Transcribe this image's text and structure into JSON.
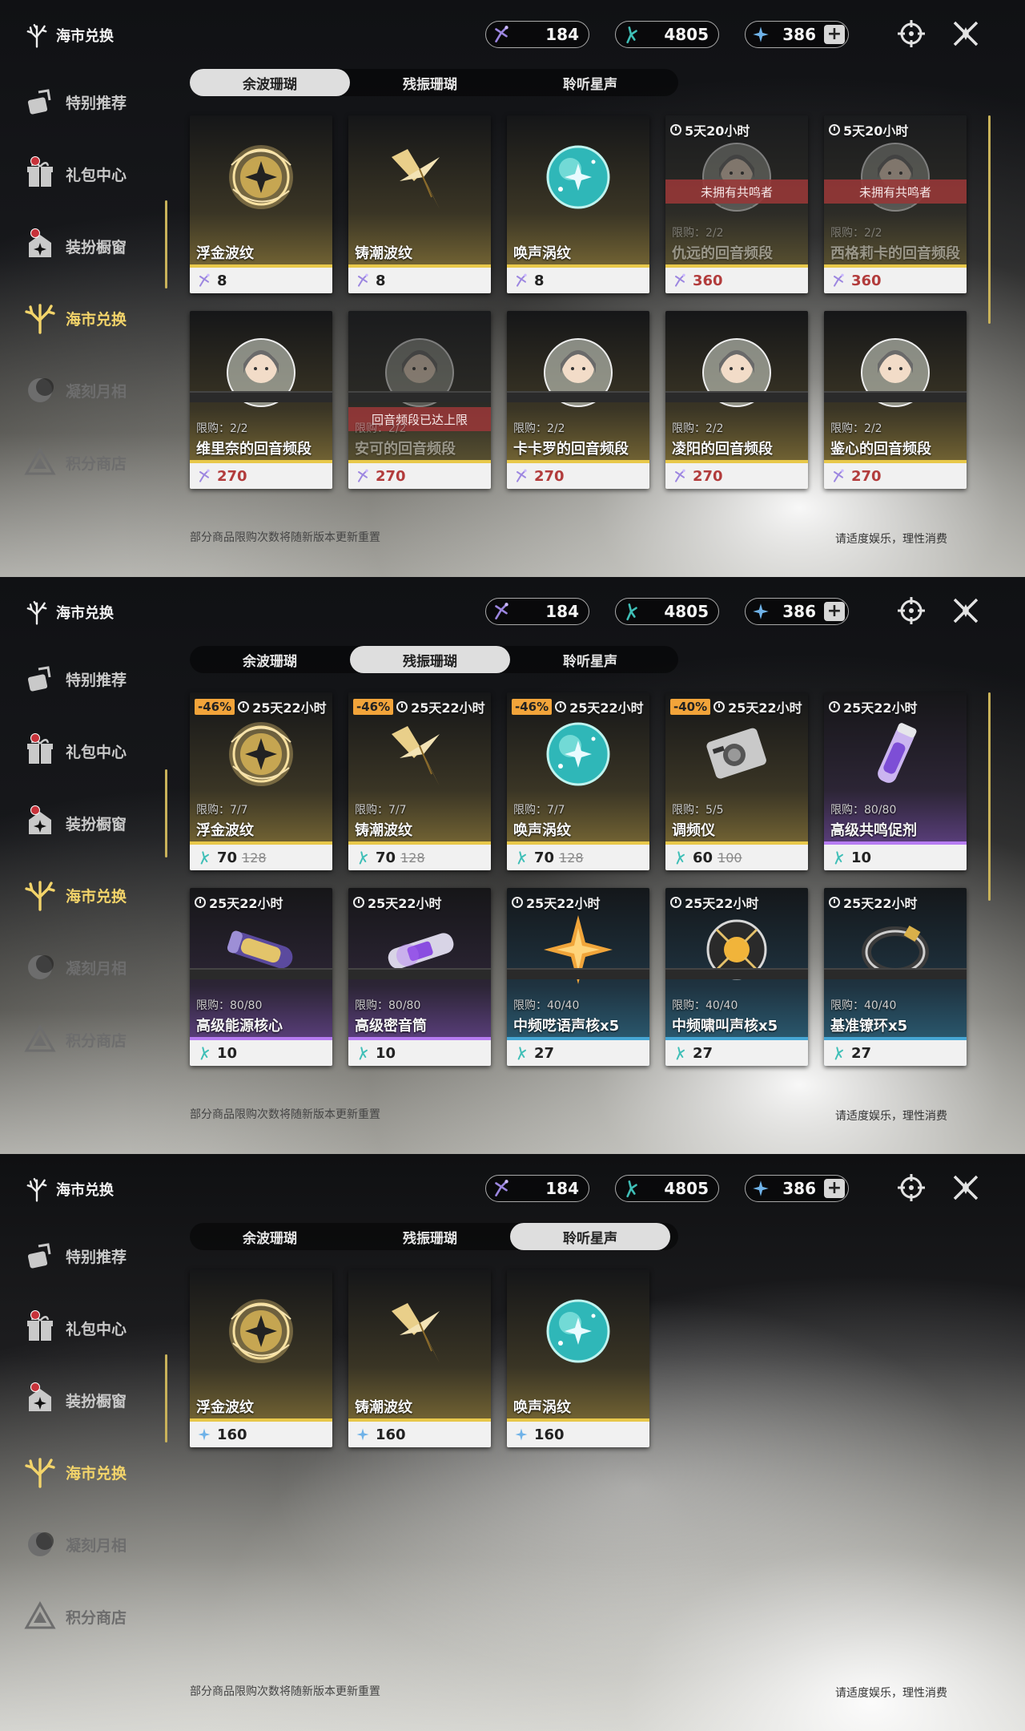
{
  "header": {
    "title": "海市兑换"
  },
  "sidebar": {
    "items": [
      {
        "label": "特别推荐",
        "icon": "recommend-icon"
      },
      {
        "label": "礼包中心",
        "icon": "gift-icon"
      },
      {
        "label": "装扮橱窗",
        "icon": "wardrobe-icon"
      },
      {
        "label": "海市兑换",
        "icon": "coral-exchange-icon"
      },
      {
        "label": "凝刻月相",
        "icon": "moon-icon"
      },
      {
        "label": "积分商店",
        "icon": "points-shop-icon"
      }
    ]
  },
  "currencies": [
    {
      "name": "coral-a",
      "value": "184",
      "color": "#b9a4e8"
    },
    {
      "name": "coral-b",
      "value": "4805",
      "color": "#6fd4d0"
    },
    {
      "name": "star-coin",
      "value": "386",
      "color": "#9fd3ff",
      "plus": "+"
    }
  ],
  "tabs": [
    "余波珊瑚",
    "残振珊瑚",
    "聆听星声"
  ],
  "panel1": {
    "cards": [
      {
        "name": "浮金波纹",
        "price": "8"
      },
      {
        "name": "铸潮波纹",
        "price": "8"
      },
      {
        "name": "唤声涡纹",
        "price": "8"
      },
      {
        "name": "仇远的回音频段",
        "price": "360",
        "timer": "5天20小时",
        "banner": "未拥有共鸣者",
        "limit": "限购：2/2"
      },
      {
        "name": "西格莉卡的回音频段",
        "price": "360",
        "timer": "5天20小时",
        "banner": "未拥有共鸣者",
        "limit": "限购：2/2"
      },
      {
        "name": "维里奈的回音频段",
        "price": "270",
        "limit": "限购：2/2"
      },
      {
        "name": "安可的回音频段",
        "price": "270",
        "limit": "限购：2/2",
        "banner": "回音频段已达上限"
      },
      {
        "name": "卡卡罗的回音频段",
        "price": "270",
        "limit": "限购：2/2"
      },
      {
        "name": "凌阳的回音频段",
        "price": "270",
        "limit": "限购：2/2"
      },
      {
        "name": "鉴心的回音频段",
        "price": "270",
        "limit": "限购：2/2"
      }
    ]
  },
  "panel2": {
    "cards": [
      {
        "name": "浮金波纹",
        "price": "70",
        "old": "128",
        "discount": "-46%",
        "timer": "25天22小时",
        "limit": "限购：7/7"
      },
      {
        "name": "铸潮波纹",
        "price": "70",
        "old": "128",
        "discount": "-46%",
        "timer": "25天22小时",
        "limit": "限购：7/7"
      },
      {
        "name": "唤声涡纹",
        "price": "70",
        "old": "128",
        "discount": "-46%",
        "timer": "25天22小时",
        "limit": "限购：7/7"
      },
      {
        "name": "调频仪",
        "price": "60",
        "old": "100",
        "discount": "-40%",
        "timer": "25天22小时",
        "limit": "限购：5/5"
      },
      {
        "name": "高级共鸣促剂",
        "price": "10",
        "timer": "25天22小时",
        "limit": "限购：80/80"
      },
      {
        "name": "高级能源核心",
        "price": "10",
        "timer": "25天22小时",
        "limit": "限购：80/80"
      },
      {
        "name": "高级密音筒",
        "price": "10",
        "timer": "25天22小时",
        "limit": "限购：80/80"
      },
      {
        "name": "中频呓语声核x5",
        "price": "27",
        "timer": "25天22小时",
        "limit": "限购：40/40"
      },
      {
        "name": "中频啸叫声核x5",
        "price": "27",
        "timer": "25天22小时",
        "limit": "限购：40/40"
      },
      {
        "name": "基准镣环x5",
        "price": "27",
        "timer": "25天22小时",
        "limit": "限购：40/40"
      }
    ]
  },
  "panel3": {
    "cards": [
      {
        "name": "浮金波纹",
        "price": "160"
      },
      {
        "name": "铸潮波纹",
        "price": "160"
      },
      {
        "name": "唤声涡纹",
        "price": "160"
      }
    ]
  },
  "footer": {
    "left": "部分商品限购次数将随新版本更新重置",
    "right": "请适度娱乐，理性消费"
  }
}
